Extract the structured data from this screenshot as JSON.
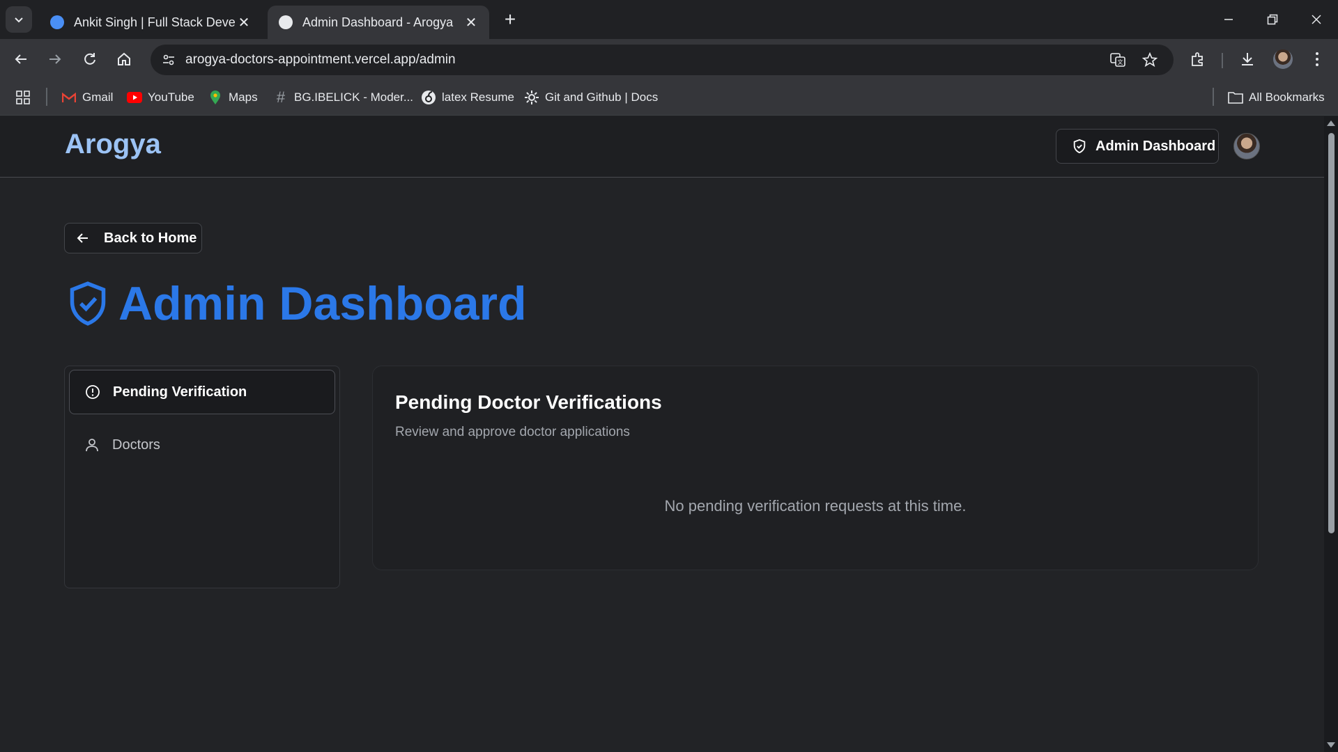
{
  "browser": {
    "tabs": [
      {
        "title": "Ankit Singh | Full Stack Develop",
        "active": false
      },
      {
        "title": "Admin Dashboard - Arogya",
        "active": true
      }
    ],
    "url": "arogya-doctors-appointment.vercel.app/admin",
    "bookmarks": [
      {
        "label": "Gmail",
        "icon": "gmail-icon"
      },
      {
        "label": "YouTube",
        "icon": "youtube-icon"
      },
      {
        "label": "Maps",
        "icon": "maps-icon"
      },
      {
        "label": "BG.IBELICK - Moder...",
        "icon": "hash-icon"
      },
      {
        "label": "latex Resume",
        "icon": "overleaf-icon"
      },
      {
        "label": "Git and Github | Docs",
        "icon": "gear-icon"
      }
    ],
    "all_bookmarks_label": "All Bookmarks"
  },
  "site": {
    "brand": "Arogya",
    "header_button": "Admin Dashboard",
    "back_button": "Back to Home",
    "page_title": "Admin Dashboard",
    "nav": [
      {
        "label": "Pending Verification",
        "icon": "alert-circle-icon",
        "active": true
      },
      {
        "label": "Doctors",
        "icon": "user-icon",
        "active": false
      }
    ],
    "card": {
      "title": "Pending Doctor Verifications",
      "subtitle": "Review and approve doctor applications",
      "empty_message": "No pending verification requests at this time."
    }
  },
  "colors": {
    "brand": "#9cc3f5",
    "accent": "#2b78e8",
    "background": "#222326"
  }
}
